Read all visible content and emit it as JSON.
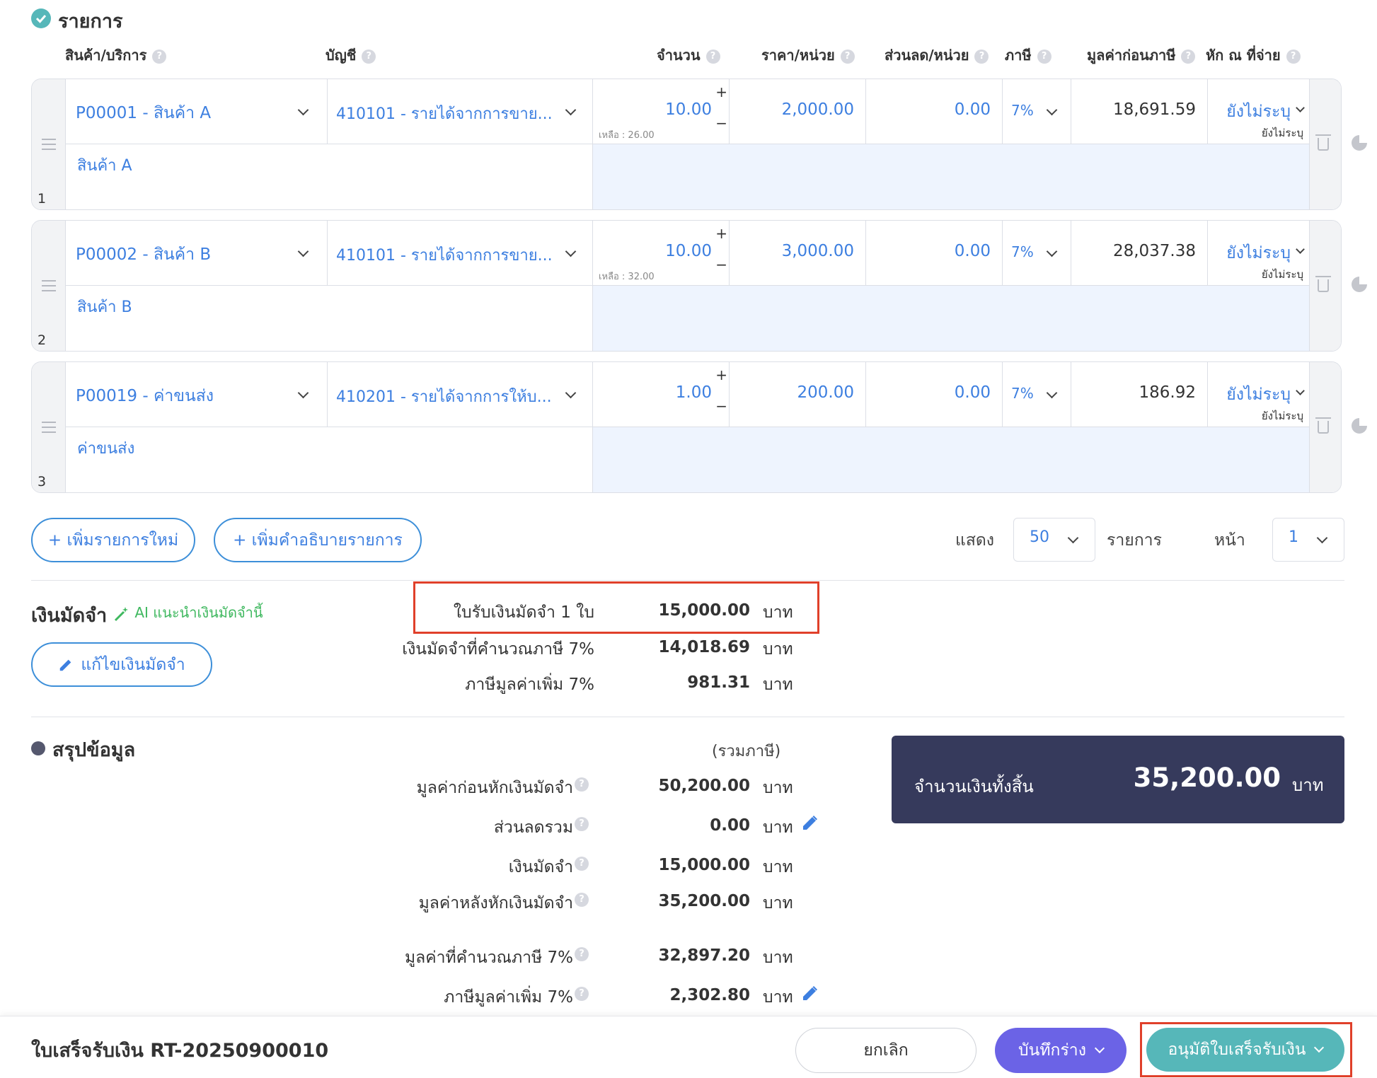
{
  "section_items": {
    "title": "รายการ"
  },
  "columns": {
    "product": "สินค้า/บริการ",
    "account": "บัญชี",
    "qty": "จำนวน",
    "price": "ราคา/หน่วย",
    "discount": "ส่วนลด/หน่วย",
    "tax": "ภาษี",
    "pretax": "มูลค่าก่อนภาษี",
    "wht": "หัก ณ ที่จ่าย"
  },
  "rows": [
    {
      "num": "1",
      "product": "P00001 - สินค้า A",
      "account": "410101 - รายได้จากการขาย...",
      "qty": "10.00",
      "remaining": "เหลือ : 26.00",
      "price": "2,000.00",
      "discount": "0.00",
      "tax": "7%",
      "pretax": "18,691.59",
      "wht": "ยังไม่ระบุ",
      "wht_sub": "ยังไม่ระบุ",
      "description": "สินค้า A"
    },
    {
      "num": "2",
      "product": "P00002 - สินค้า B",
      "account": "410101 - รายได้จากการขาย...",
      "qty": "10.00",
      "remaining": "เหลือ : 32.00",
      "price": "3,000.00",
      "discount": "0.00",
      "tax": "7%",
      "pretax": "28,037.38",
      "wht": "ยังไม่ระบุ",
      "wht_sub": "ยังไม่ระบุ",
      "description": "สินค้า B"
    },
    {
      "num": "3",
      "product": "P00019 - ค่าขนส่ง",
      "account": "410201 - รายได้จากการให้บ...",
      "qty": "1.00",
      "remaining": "",
      "price": "200.00",
      "discount": "0.00",
      "tax": "7%",
      "pretax": "186.92",
      "wht": "ยังไม่ระบุ",
      "wht_sub": "ยังไม่ระบุ",
      "description": "ค่าขนส่ง"
    }
  ],
  "actions": {
    "add_item": "+ เพิ่มรายการใหม่",
    "add_desc": "+ เพิ่มคำอธิบายรายการ"
  },
  "pagination": {
    "show_label": "แสดง",
    "per_page": "50",
    "items_label": "รายการ",
    "page_label": "หน้า",
    "page": "1"
  },
  "deposit": {
    "title": "เงินมัดจำ",
    "ai_hint": "AI แนะนำเงินมัดจำนี้",
    "edit_button": "แก้ไขเงินมัดจำ",
    "receipt_link": "ใบรับเงินมัดจำ 1 ใบ",
    "receipt_amount": "15,000.00",
    "taxable_label": "เงินมัดจำที่คำนวณภาษี 7%",
    "taxable_amount": "14,018.69",
    "vat_label": "ภาษีมูลค่าเพิ่ม 7%",
    "vat_amount": "981.31",
    "unit": "บาท"
  },
  "summary": {
    "title": "สรุปข้อมูล",
    "incl_tax": "(รวมภาษี)",
    "lines": [
      {
        "label": "มูลค่าก่อนหักเงินมัดจำ",
        "value": "50,200.00"
      },
      {
        "label": "ส่วนลดรวม",
        "value": "0.00"
      },
      {
        "label": "เงินมัดจำ",
        "value": "15,000.00"
      },
      {
        "label": "มูลค่าหลังหักเงินมัดจำ",
        "value": "35,200.00"
      },
      {
        "label": "มูลค่าที่คำนวณภาษี 7%",
        "value": "32,897.20"
      },
      {
        "label": "ภาษีมูลค่าเพิ่ม 7%",
        "value": "2,302.80"
      }
    ],
    "unit": "บาท",
    "total_label": "จำนวนเงินทั้งสิ้น",
    "total_value": "35,200.00",
    "total_unit": "บาท"
  },
  "footer": {
    "doc_title": "ใบเสร็จรับเงิน RT-20250900010",
    "cancel": "ยกเลิก",
    "save_draft": "บันทึกร่าง",
    "approve": "อนุมัติใบเสร็จรับเงิน"
  },
  "colors": {
    "accent": "#3d7fe0",
    "teal": "#56b7b9",
    "purple": "#6b63e6",
    "navy": "#363a5c",
    "highlight": "#e0402a"
  }
}
